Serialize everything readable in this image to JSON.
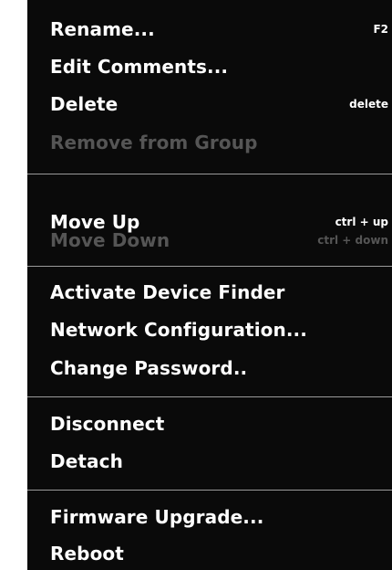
{
  "menu": {
    "items": [
      {
        "label": "Rename...",
        "shortcut": "F2",
        "enabled": true
      },
      {
        "label": "Edit Comments...",
        "shortcut": "",
        "enabled": true
      },
      {
        "label": "Delete",
        "shortcut": "delete",
        "enabled": true
      },
      {
        "label": "Remove from Group",
        "shortcut": "",
        "enabled": false
      },
      {
        "label": "Move Up",
        "shortcut": "ctrl + up",
        "enabled": true
      },
      {
        "label": "Move Down",
        "shortcut": "ctrl + down",
        "enabled": false
      },
      {
        "label": "Activate Device Finder",
        "shortcut": "",
        "enabled": true
      },
      {
        "label": "Network Configuration...",
        "shortcut": "",
        "enabled": true
      },
      {
        "label": "Change Password..",
        "shortcut": "",
        "enabled": true
      },
      {
        "label": "Disconnect",
        "shortcut": "",
        "enabled": true
      },
      {
        "label": "Detach",
        "shortcut": "",
        "enabled": true
      },
      {
        "label": "Firmware Upgrade...",
        "shortcut": "",
        "enabled": true
      },
      {
        "label": "Reboot",
        "shortcut": "",
        "enabled": true
      }
    ]
  }
}
